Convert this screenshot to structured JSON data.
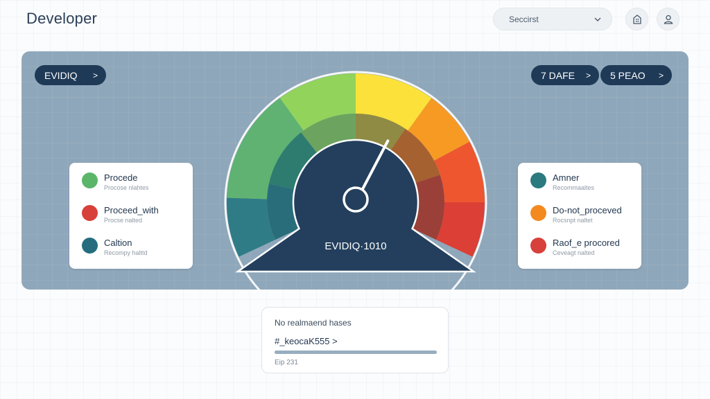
{
  "header": {
    "title": "Developer",
    "select": {
      "value": "Seccirst"
    },
    "icons": [
      "building-icon",
      "user-icon"
    ]
  },
  "panel": {
    "top_left_pill": "EVIDIQ",
    "top_right_pills": [
      "7 DAFE",
      "5 PEAO"
    ],
    "gauge": {
      "label": "EVIDIQ·1010",
      "outer_colors": [
        "#2f7c86",
        "#5fb272",
        "#92d35c",
        "#fbe13a",
        "#f79a24",
        "#ee5630",
        "#dc3f35"
      ],
      "inner_colors": [
        "#296d7b",
        "#2e7c6f",
        "#6ca45f",
        "#8f8b44",
        "#a66130",
        "#9b4038"
      ],
      "dial_color": "#233f5d",
      "needle_value_fraction": 0.62
    },
    "left_legend": [
      {
        "title": "Procede",
        "subtitle": "Procose nlahtes",
        "color": "#5cb66a"
      },
      {
        "title": "Proceed_with",
        "subtitle": "Procse nalted",
        "color": "#d7403b"
      },
      {
        "title": "Caltion",
        "subtitle": "Recompy halttd",
        "color": "#256d7e"
      }
    ],
    "right_legend": [
      {
        "title": "Amner",
        "subtitle": "Recommaaltes",
        "color": "#2b7a80"
      },
      {
        "title": "Do-not_proceved",
        "subtitle": "Rocsnpt naltet",
        "color": "#f38a20"
      },
      {
        "title": "Raof_e procored",
        "subtitle": "Ceveagt nalted",
        "color": "#d7403b"
      }
    ]
  },
  "info_card": {
    "title": "No realmaend hases",
    "main": "#_keocaK555 >",
    "progress_fraction": 1.0,
    "sub": "Eip 231"
  }
}
